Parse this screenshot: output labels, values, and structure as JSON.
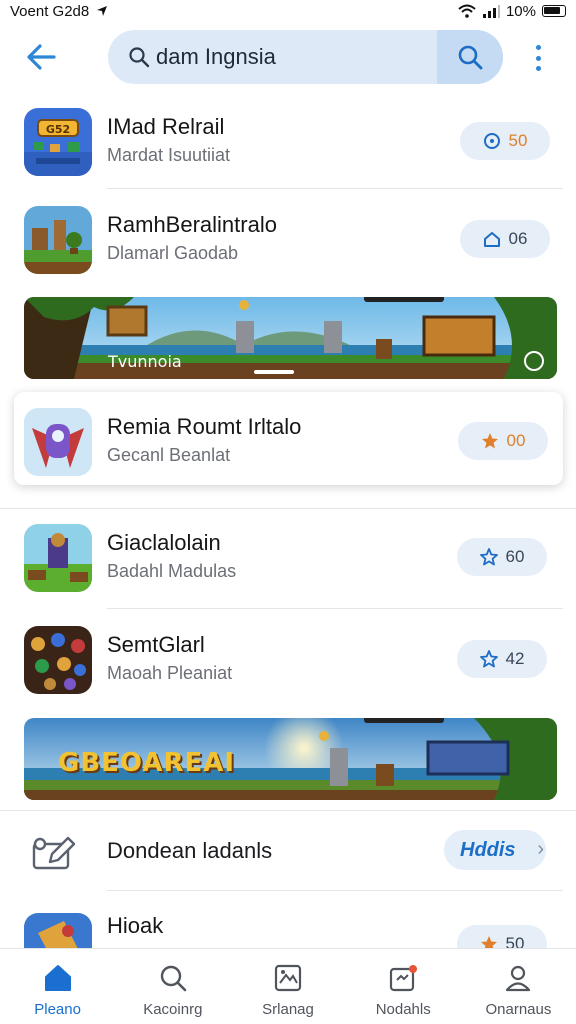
{
  "status_bar": {
    "carrier": "Voent G2d8",
    "battery": "10%"
  },
  "search": {
    "query": "dam Ingnsia"
  },
  "colors": {
    "accent": "#2e86d6",
    "pill_bg": "#e6eef8",
    "star": "#e0802a"
  },
  "apps": [
    {
      "title": "IMad Relrail",
      "subtitle": "Mardat Isuutiiat",
      "badge_icon": "clock-icon",
      "badge": "50"
    },
    {
      "title": "RamhBeralintralo",
      "subtitle": "Dlamarl Gaodab",
      "badge_icon": "house-icon",
      "badge": "06"
    },
    {
      "title": "Remia Roumt Irltalo",
      "subtitle": "Gecanl Beanlat",
      "badge_icon": "star-icon",
      "badge": "00"
    },
    {
      "title": "Giaclalolain",
      "subtitle": "Badahl Madulas",
      "badge_icon": "star-outline-icon",
      "badge": "60"
    },
    {
      "title": "SemtGlarl",
      "subtitle": "Maoah Pleaniat",
      "badge_icon": "star-outline-icon",
      "badge": "42"
    },
    {
      "title": "Hioak",
      "subtitle": "",
      "badge_icon": "star-icon",
      "badge": "50"
    }
  ],
  "banners": [
    {
      "label": "Tvunnoia"
    },
    {
      "logo": "GBEOAREAI"
    }
  ],
  "action_row": {
    "text": "Dondean ladanls",
    "button": "Hddis"
  },
  "bottom_nav": [
    {
      "label": "Pleano",
      "icon": "home-icon",
      "active": true
    },
    {
      "label": "Kacoinrg",
      "icon": "search-icon",
      "active": false
    },
    {
      "label": "Srlanag",
      "icon": "gallery-icon",
      "active": false
    },
    {
      "label": "Nodahls",
      "icon": "notification-icon",
      "active": false
    },
    {
      "label": "Onarnaus",
      "icon": "profile-icon",
      "active": false
    }
  ]
}
